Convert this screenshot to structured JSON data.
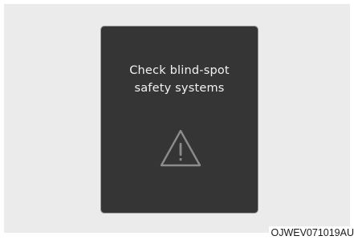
{
  "warning_panel": {
    "message_line_1": "Check blind-spot",
    "message_line_2": "safety systems",
    "icon": "warning-triangle-icon"
  },
  "figure_code": "OJWEV071019AU",
  "colors": {
    "backdrop": "#ebebeb",
    "panel": "#353535",
    "panel_border": "#9a9a9a",
    "message_text": "#f2f2f2",
    "icon_stroke": "#8c8c8c"
  }
}
